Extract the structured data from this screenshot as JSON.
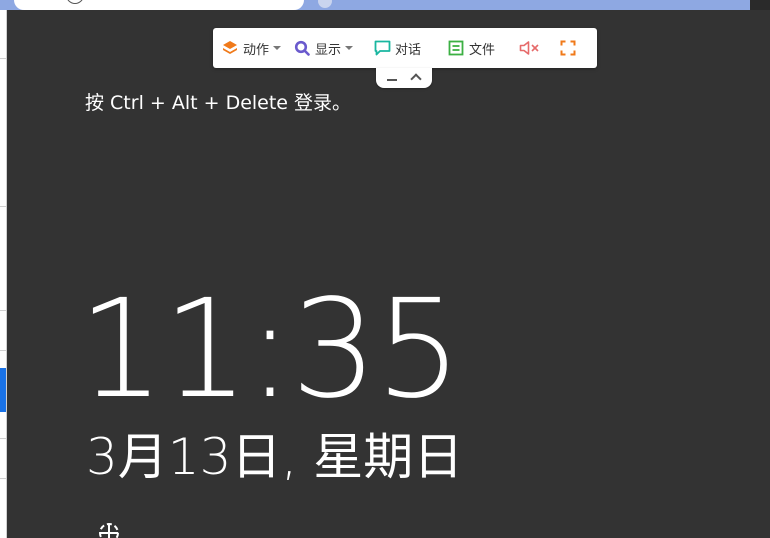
{
  "toolbar": {
    "action_label": "动作",
    "display_label": "显示",
    "chat_label": "对话",
    "file_label": "文件",
    "icons": {
      "action": "layers-icon",
      "display": "magnifier-icon",
      "chat": "chat-bubble-icon",
      "file": "file-icon",
      "mute": "speaker-muted-icon",
      "fullscreen": "fullscreen-icon",
      "minimize": "minus-icon",
      "collapse": "chevron-up-icon"
    },
    "colors": {
      "action": "#f07a1a",
      "display": "#6a5acd",
      "chat": "#19b6a0",
      "file": "#3cb043",
      "mute": "#e66a6a",
      "fullscreen": "#f07a1a"
    }
  },
  "lock_screen": {
    "prompt": "按 Ctrl + Alt + Delete 登录。",
    "time": "11:35",
    "date": "3月13日, 星期日",
    "background": "#333333",
    "ease_icon": "ease-of-access-icon"
  }
}
